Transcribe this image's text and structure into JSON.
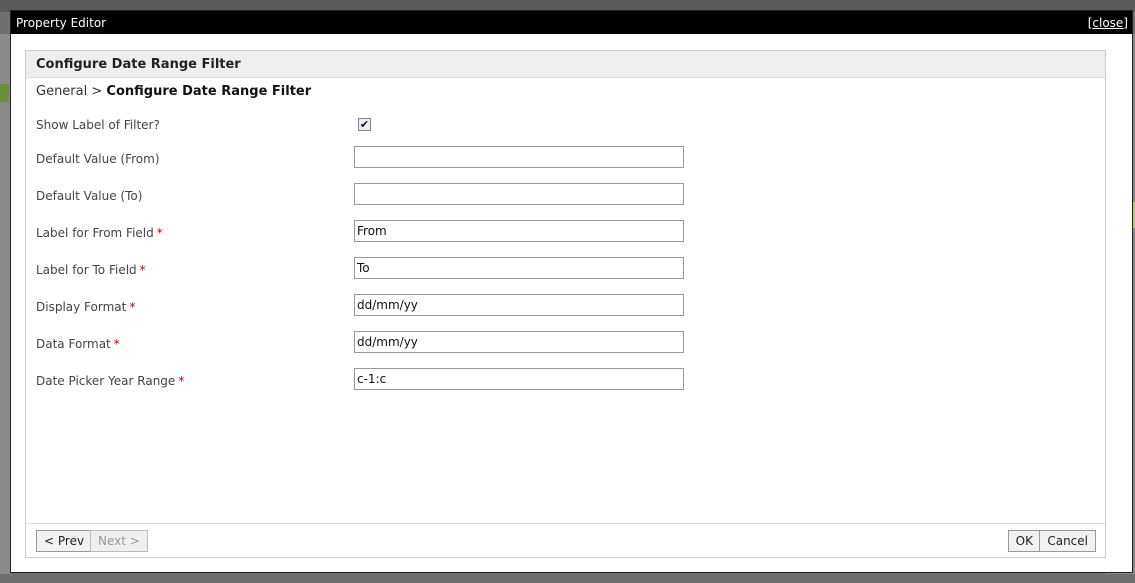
{
  "window": {
    "title": "Property Editor",
    "close_label": "[close]"
  },
  "panel": {
    "title": "Configure Date Range Filter"
  },
  "breadcrumb": {
    "parent": "General",
    "separator": ">",
    "current": "Configure Date Range Filter"
  },
  "fields": [
    {
      "label": "Show Label of Filter?",
      "type": "checkbox",
      "checked": true,
      "check_glyph": "✔"
    },
    {
      "label": "Default Value (From)",
      "value": "",
      "required": false
    },
    {
      "label": "Default Value (To)",
      "value": "",
      "required": false
    },
    {
      "label": "Label for From Field",
      "value": "From",
      "required": true
    },
    {
      "label": "Label for To Field",
      "value": "To",
      "required": true
    },
    {
      "label": "Display Format",
      "value": "dd/mm/yy",
      "required": true
    },
    {
      "label": "Data Format",
      "value": "dd/mm/yy",
      "required": true
    },
    {
      "label": "Date Picker Year Range",
      "value": "c-1:c",
      "required": true
    }
  ],
  "required_marker": "*",
  "footer": {
    "prev_label": "< Prev",
    "next_label": "Next >",
    "ok_label": "OK",
    "cancel_label": "Cancel"
  },
  "colors": {
    "titlebar": "#000000",
    "required": "#cc0000",
    "header_bg": "#eeeeee"
  }
}
